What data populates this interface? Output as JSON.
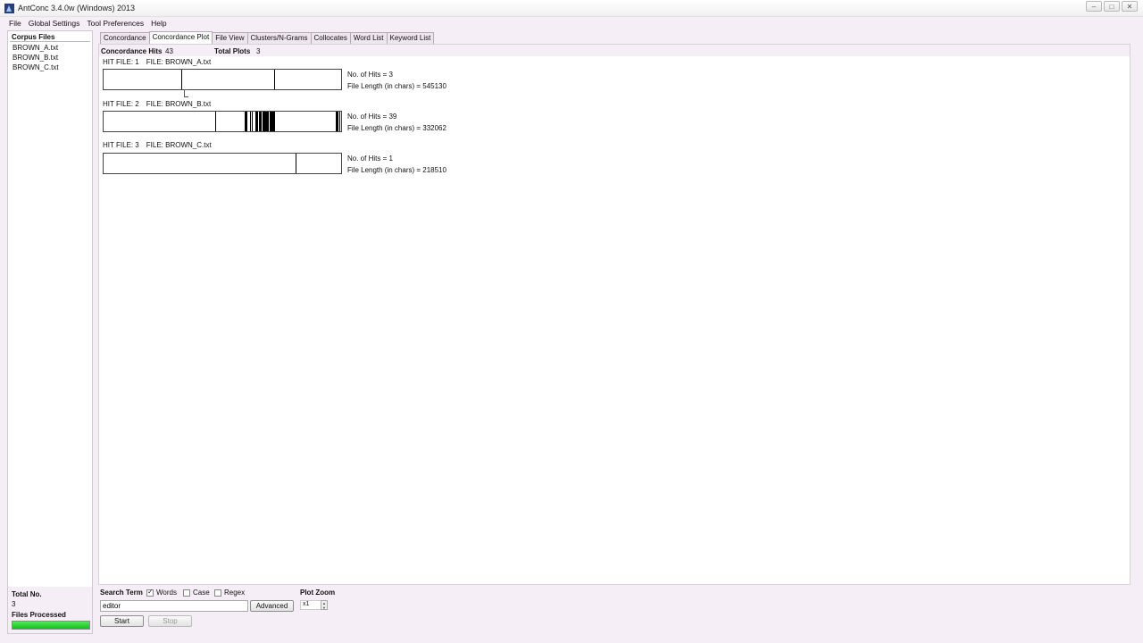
{
  "window": {
    "title": "AntConc 3.4.0w (Windows) 2013"
  },
  "menu": [
    "File",
    "Global Settings",
    "Tool Preferences",
    "Help"
  ],
  "left_panel": {
    "title": "Corpus Files",
    "files": [
      "BROWN_A.txt",
      "BROWN_B.txt",
      "BROWN_C.txt"
    ],
    "total_label": "Total No.",
    "total_value": "3",
    "files_processed_label": "Files Processed",
    "files_processed_progress": 1.0
  },
  "tabs": [
    {
      "label": "Concordance",
      "active": false
    },
    {
      "label": "Concordance Plot",
      "active": true
    },
    {
      "label": "File View",
      "active": false
    },
    {
      "label": "Clusters/N-Grams",
      "active": false
    },
    {
      "label": "Collocates",
      "active": false
    },
    {
      "label": "Word List",
      "active": false
    },
    {
      "label": "Keyword List",
      "active": false
    }
  ],
  "summary": {
    "hits_label": "Concordance Hits",
    "hits_value": "43",
    "plots_label": "Total Plots",
    "plots_value": "3"
  },
  "plots": [
    {
      "hit_file": "HIT FILE: 1",
      "file": "FILE: BROWN_A.txt",
      "hits_text": "No. of Hits = 3",
      "length_text": "File Length (in chars) = 545130",
      "hit_positions": [
        0.33,
        0.72,
        0.722
      ]
    },
    {
      "hit_file": "HIT FILE: 2",
      "file": "FILE: BROWN_B.txt",
      "hits_text": "No. of Hits = 39",
      "length_text": "File Length (in chars) = 332062",
      "hit_positions": [
        0.47,
        0.595,
        0.6,
        0.605,
        0.62,
        0.625,
        0.64,
        0.645,
        0.65,
        0.655,
        0.66,
        0.665,
        0.67,
        0.675,
        0.678,
        0.681,
        0.684,
        0.687,
        0.69,
        0.693,
        0.696,
        0.7,
        0.703,
        0.706,
        0.709,
        0.712,
        0.715,
        0.718,
        0.72,
        0.69,
        0.688,
        0.686,
        0.7,
        0.98,
        0.985,
        0.99,
        0.995,
        0.62,
        0.605
      ]
    },
    {
      "hit_file": "HIT FILE: 3",
      "file": "FILE: BROWN_C.txt",
      "hits_text": "No. of Hits = 1",
      "length_text": "File Length (in chars) = 218510",
      "hit_positions": [
        0.81
      ]
    }
  ],
  "controls": {
    "search_label": "Search Term",
    "words_label": "Words",
    "words_checked": true,
    "case_label": "Case",
    "case_checked": false,
    "regex_label": "Regex",
    "regex_checked": false,
    "search_value": "editor",
    "advanced_label": "Advanced",
    "start_label": "Start",
    "stop_label": "Stop",
    "zoom_label": "Plot Zoom",
    "zoom_value": "x1"
  },
  "icons": [
    "app-icon",
    "minimize-icon",
    "maximize-icon",
    "close-icon",
    "checkbox-icon",
    "spinner-icon"
  ]
}
